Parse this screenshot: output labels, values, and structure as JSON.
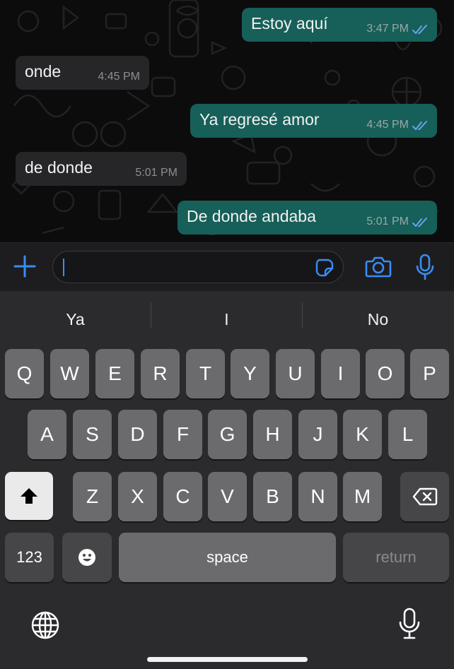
{
  "colors": {
    "outgoing_bubble": "#175f59",
    "incoming_bubble": "#262628",
    "accent": "#3c8cf6",
    "read_ticks": "#5fa8f0"
  },
  "messages": [
    {
      "direction": "out",
      "text": "Estoy aquí",
      "time": "3:47 PM",
      "status": "read"
    },
    {
      "direction": "in",
      "text": "onde",
      "time": "4:45 PM"
    },
    {
      "direction": "out",
      "text": "Ya regresé amor",
      "time": "4:45 PM",
      "status": "read"
    },
    {
      "direction": "in",
      "text": "de donde",
      "time": "5:01 PM"
    },
    {
      "direction": "out",
      "text": "De donde andaba",
      "time": "5:01 PM",
      "status": "read"
    }
  ],
  "composer": {
    "attach_icon": "plus-icon",
    "sticker_icon": "sticker-icon",
    "camera_icon": "camera-icon",
    "mic_icon": "microphone-icon",
    "value": ""
  },
  "keyboard": {
    "suggestions": [
      "Ya",
      "I",
      "No"
    ],
    "row1": [
      "Q",
      "W",
      "E",
      "R",
      "T",
      "Y",
      "U",
      "I",
      "O",
      "P"
    ],
    "row2": [
      "A",
      "S",
      "D",
      "F",
      "G",
      "H",
      "J",
      "K",
      "L"
    ],
    "row3": [
      "Z",
      "X",
      "C",
      "V",
      "B",
      "N",
      "M"
    ],
    "numbers_label": "123",
    "space_label": "space",
    "return_label": "return",
    "shift_icon": "shift-icon",
    "delete_icon": "backspace-icon",
    "emoji_icon": "emoji-icon",
    "globe_icon": "globe-icon",
    "dictation_icon": "microphone-icon"
  }
}
